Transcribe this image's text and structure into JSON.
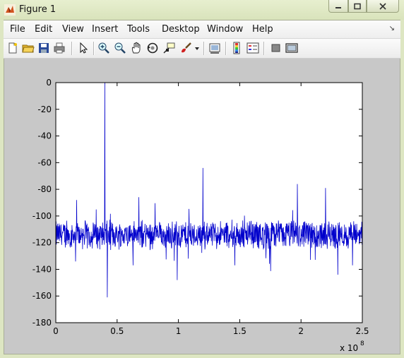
{
  "window": {
    "title": "Figure 1"
  },
  "menu": {
    "items": [
      "File",
      "Edit",
      "View",
      "Insert",
      "Tools",
      "Desktop",
      "Window",
      "Help"
    ]
  },
  "toolbar": {
    "icons": [
      "new-figure-icon",
      "open-file-icon",
      "save-icon",
      "print-icon",
      "select-arrow-icon",
      "zoom-in-icon",
      "zoom-out-icon",
      "pan-icon",
      "rotate-3d-icon",
      "data-cursor-icon",
      "brush-icon",
      "brush-dropdown-icon",
      "link-plot-icon",
      "insert-colorbar-icon",
      "insert-legend-icon",
      "hide-plot-tools-icon",
      "show-plot-tools-icon"
    ]
  },
  "colors": {
    "line": "#0000cc",
    "axes_bg": "#ffffff",
    "figure_bg": "#c8c8c8"
  },
  "chart_data": {
    "type": "line",
    "title": "",
    "xlabel": "",
    "ylabel": "",
    "xlim": [
      0,
      2.5
    ],
    "ylim": [
      -180,
      0
    ],
    "x_exponent_label": "x 10",
    "x_exponent_power": "8",
    "xticks": [
      0,
      0.5,
      1,
      1.5,
      2,
      2.5
    ],
    "xtick_labels": [
      "0",
      "0.5",
      "1",
      "1.5",
      "2",
      "2.5"
    ],
    "yticks": [
      0,
      -20,
      -40,
      -60,
      -80,
      -100,
      -120,
      -140,
      -160,
      -180
    ],
    "ytick_labels": [
      "0",
      "-20",
      "-40",
      "-60",
      "-80",
      "-100",
      "-120",
      "-140",
      "-160",
      "-180"
    ],
    "grid": false,
    "series": [
      {
        "baseline": -114,
        "noise_amplitude": 10,
        "spikes": [
          {
            "x": 0.4,
            "y": 0
          },
          {
            "x": 0.42,
            "y": -161
          },
          {
            "x": 1.2,
            "y": -64
          },
          {
            "x": 0.99,
            "y": -148
          },
          {
            "x": 2.2,
            "y": -79
          },
          {
            "x": 1.97,
            "y": -76
          },
          {
            "x": 2.3,
            "y": -144
          },
          {
            "x": 2.42,
            "y": -137
          },
          {
            "x": 0.17,
            "y": -88
          },
          {
            "x": 0.63,
            "y": -137
          },
          {
            "x": 1.46,
            "y": -137
          },
          {
            "x": 1.08,
            "y": -132
          }
        ]
      }
    ]
  }
}
